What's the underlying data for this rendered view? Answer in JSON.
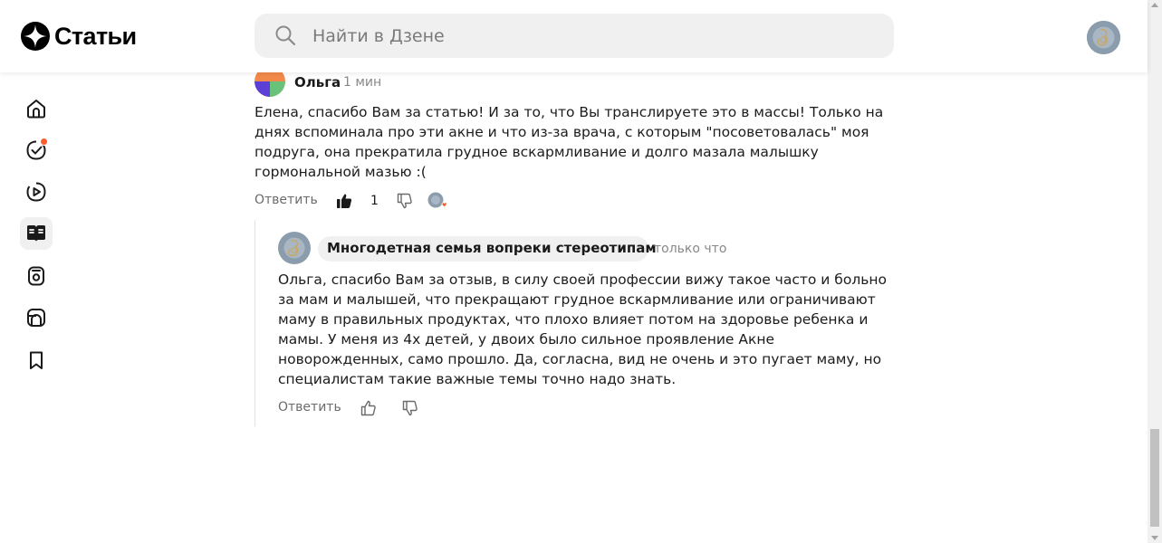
{
  "header": {
    "logo_text": "Статьи",
    "search_placeholder": "Найти в Дзене"
  },
  "nav": {
    "items": [
      {
        "icon": "home-icon"
      },
      {
        "icon": "subscriptions-icon",
        "has_notification": true
      },
      {
        "icon": "video-icon"
      },
      {
        "icon": "articles-icon",
        "active": true
      },
      {
        "icon": "shorts-icon"
      },
      {
        "icon": "shop-icon"
      },
      {
        "icon": "bookmark-icon"
      }
    ]
  },
  "comments": [
    {
      "author": "Ольга",
      "time": "1 мин",
      "text": "Елена, спасибо Вам за статью! И за то, что Вы транслируете это в массы! Только на\nднях вспоминала про эти акне и что из-за врача, с которым \"посоветовалась\" моя\nподруга, она прекратила грудное вскармливание и долго мазала малышку\nгормональной мазью :(",
      "reply_label": "Ответить",
      "likes": "1"
    }
  ],
  "reply": {
    "author": "Многодетная семья вопреки стереотипам",
    "time": "только что",
    "text": "Ольга, спасибо Вам за отзыв, в силу своей профессии вижу такое часто и больно\nза мам и малышей, что прекращают грудное вскармливание или ограничивают\nмаму в правильных продуктах, что плохо влияет потом на здоровье ребенка и\nмамы. У меня из 4х детей, у двоих было сильное проявление Акне\nноворожденных, само прошло. Да, согласна, вид не очень и это пугает маму, но\nспециалистам такие важные темы точно надо знать.",
    "reply_label": "Ответить"
  },
  "colors": {
    "accent_dot": "#ff5c2b",
    "search_bg": "#f0f0f0"
  }
}
